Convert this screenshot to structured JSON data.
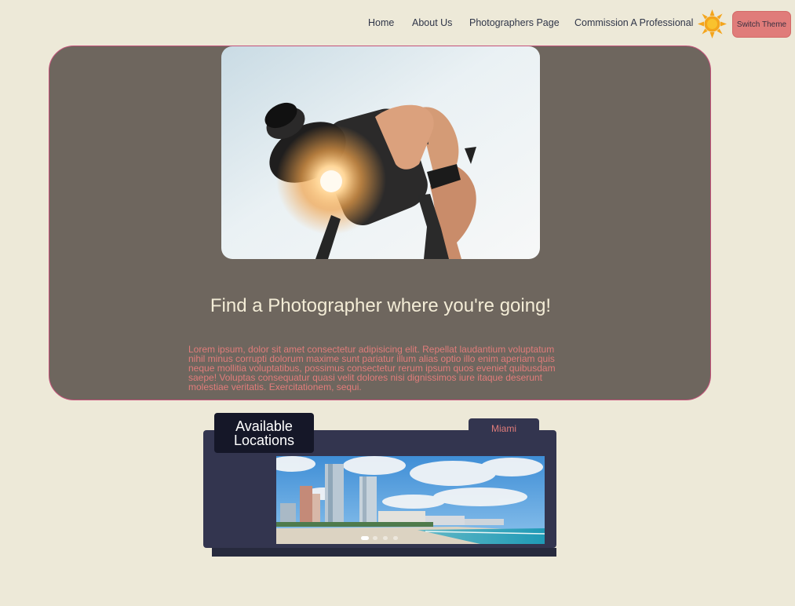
{
  "nav": {
    "links": [
      "Home",
      "About Us",
      "Photographers Page",
      "Commission A Professional"
    ],
    "theme_icon": "sun-icon",
    "switch_theme_label": "Switch Theme"
  },
  "hero": {
    "title": "Find a Photographer where you're going!",
    "body": "Lorem ipsum, dolor sit amet consectetur adipisicing elit. Repellat laudantium voluptatum nihil minus corrupti dolorum maxime sunt pariatur illum alias optio illo enim aperiam quis neque mollitia voluptatibus, possimus consectetur rerum ipsum quos eveniet quibusdam saepe! Voluptas consequatur quasi velit dolores nisi dignissimos iure itaque deserunt molestiae veritatis. Exercitationem, sequi."
  },
  "locations": {
    "title_line1": "Available",
    "title_line2": "Locations",
    "tab_label": "Miami",
    "slide_count": 4,
    "active_slide": 1
  },
  "colors": {
    "background": "#ede9d8",
    "hero_panel": "#6e665e",
    "hero_border": "#c4527a",
    "accent": "#e07c7a",
    "locations_panel": "#33354f",
    "locations_title_bg": "#151728",
    "sun": "#f4a51c"
  }
}
